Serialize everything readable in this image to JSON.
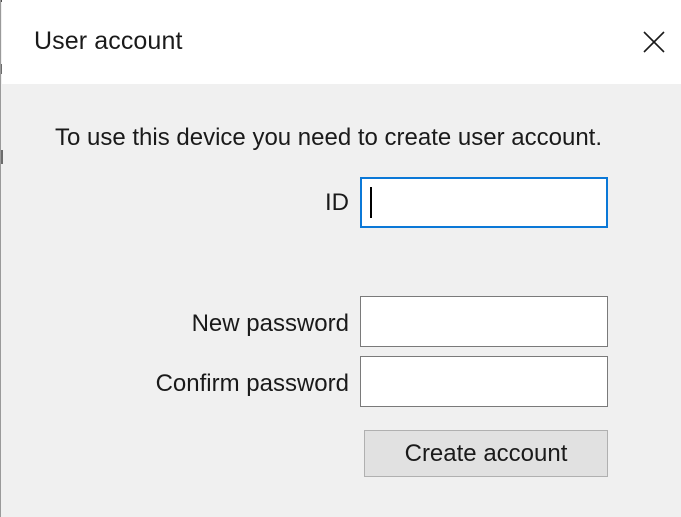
{
  "window": {
    "title": "User account",
    "close_icon": "close-icon"
  },
  "form": {
    "instruction": "To use this device you need to create user account.",
    "id_label": "ID",
    "id_value": "",
    "new_password_label": "New password",
    "new_password_value": "",
    "confirm_password_label": "Confirm password",
    "confirm_password_value": "",
    "create_button_label": "Create account"
  },
  "colors": {
    "focus_border": "#0b78d7",
    "dialog_background": "#f0f0f0",
    "titlebar_background": "#ffffff",
    "button_background": "#e1e1e1"
  }
}
